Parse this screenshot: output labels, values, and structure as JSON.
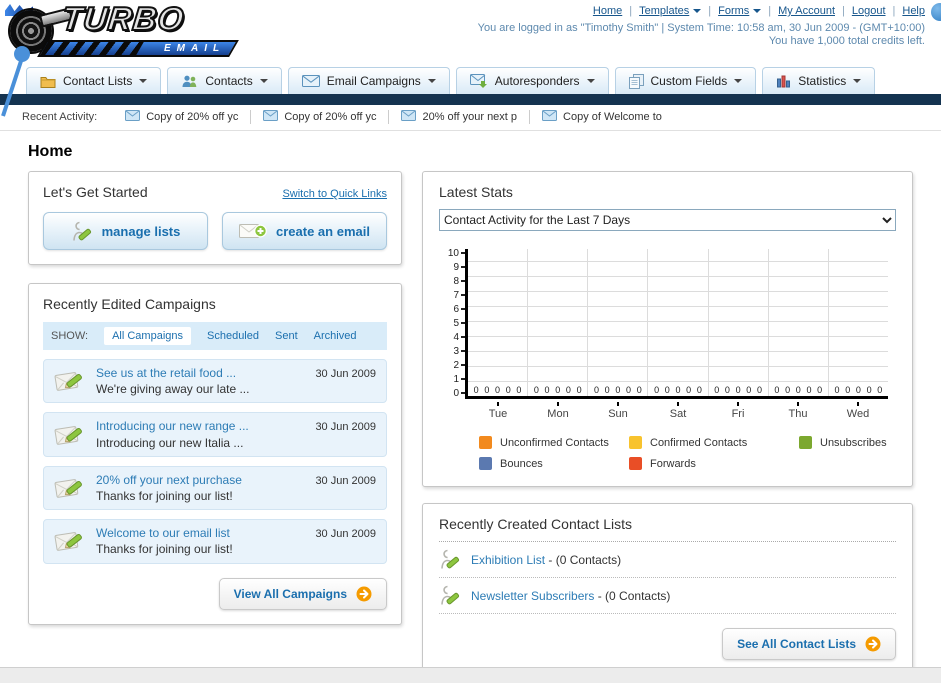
{
  "brand": {
    "name": "TURBO",
    "sub": "EMAIL"
  },
  "header": {
    "links": [
      {
        "label": "Home"
      },
      {
        "label": "Templates",
        "caret": true
      },
      {
        "label": "Forms",
        "caret": true
      },
      {
        "label": "My Account"
      },
      {
        "label": "Logout"
      },
      {
        "label": "Help"
      }
    ],
    "login_text": "You are logged in as \"Timothy Smith\" | System Time: 10:58 am, 30 Jun 2009 - (GMT+10:00)",
    "credits_text": "You have 1,000 total credits left."
  },
  "nav": {
    "tabs": [
      {
        "id": "contact-lists",
        "label": "Contact Lists",
        "icon": "folder-icon"
      },
      {
        "id": "contacts",
        "label": "Contacts",
        "icon": "contacts-icon"
      },
      {
        "id": "email-campaigns",
        "label": "Email Campaigns",
        "icon": "envelope-icon"
      },
      {
        "id": "autoresponders",
        "label": "Autoresponders",
        "icon": "autoresponder-icon"
      },
      {
        "id": "custom-fields",
        "label": "Custom Fields",
        "icon": "custom-fields-icon"
      },
      {
        "id": "statistics",
        "label": "Statistics",
        "icon": "statistics-icon"
      }
    ]
  },
  "recent_activity": {
    "label": "Recent Activity:",
    "icon": "mail-small-icon",
    "items": [
      "Copy of 20% off yc",
      "Copy of 20% off yc",
      "20% off your next p",
      "Copy of Welcome to"
    ]
  },
  "page_title": "Home",
  "get_started": {
    "title": "Let's Get Started",
    "switch_link": "Switch to Quick Links",
    "manage_button": "manage lists",
    "manage_icon": "pencil-person-icon",
    "create_button": "create an email",
    "create_icon": "envelope-plus-icon"
  },
  "campaigns": {
    "title": "Recently Edited Campaigns",
    "show_label": "SHOW:",
    "filters": [
      {
        "label": "All Campaigns",
        "selected": true
      },
      {
        "label": "Scheduled"
      },
      {
        "label": "Sent"
      },
      {
        "label": "Archived"
      }
    ],
    "item_icon": "envelope-pencil-icon",
    "items": [
      {
        "title": "See us at the retail food ...",
        "subtitle": "We're giving away our late ...",
        "date": "30 Jun 2009"
      },
      {
        "title": "Introducing our new range ...",
        "subtitle": "Introducing our new Italia ...",
        "date": "30 Jun 2009"
      },
      {
        "title": "20% off your next purchase",
        "subtitle": "Thanks for joining our list!",
        "date": "30 Jun 2009"
      },
      {
        "title": "Welcome to our email list",
        "subtitle": "Thanks for joining our list!",
        "date": "30 Jun 2009"
      }
    ],
    "view_all": "View All Campaigns",
    "arrow_icon": "arrow-circle-icon"
  },
  "stats": {
    "title": "Latest Stats",
    "dropdown_value": "Contact Activity for the Last 7 Days"
  },
  "chart_data": {
    "type": "bar",
    "title": "Contact Activity for the Last 7 Days",
    "x": [
      "Tue",
      "Mon",
      "Sun",
      "Sat",
      "Fri",
      "Thu",
      "Wed"
    ],
    "series": [
      {
        "name": "Unconfirmed Contacts",
        "color": "#F28A1E",
        "values": [
          0,
          0,
          0,
          0,
          0,
          0,
          0
        ]
      },
      {
        "name": "Confirmed Contacts",
        "color": "#F8C32E",
        "values": [
          0,
          0,
          0,
          0,
          0,
          0,
          0
        ]
      },
      {
        "name": "Unsubscribes",
        "color": "#7CA82F",
        "values": [
          0,
          0,
          0,
          0,
          0,
          0,
          0
        ]
      },
      {
        "name": "Bounces",
        "color": "#5B79B0",
        "values": [
          0,
          0,
          0,
          0,
          0,
          0,
          0
        ]
      },
      {
        "name": "Forwards",
        "color": "#E94E26",
        "values": [
          0,
          0,
          0,
          0,
          0,
          0,
          0
        ]
      }
    ],
    "ylim": [
      0,
      10
    ],
    "ytick_step": 1,
    "grid": true,
    "legend_position": "bottom"
  },
  "contact_lists": {
    "title": "Recently Created Contact Lists",
    "item_icon": "pencil-person-icon",
    "items": [
      {
        "name": "Exhibition List",
        "count": "- (0 Contacts)"
      },
      {
        "name": "Newsletter Subscribers",
        "count": "- (0 Contacts)"
      }
    ],
    "see_all": "See All Contact Lists",
    "arrow_icon": "arrow-circle-icon"
  }
}
